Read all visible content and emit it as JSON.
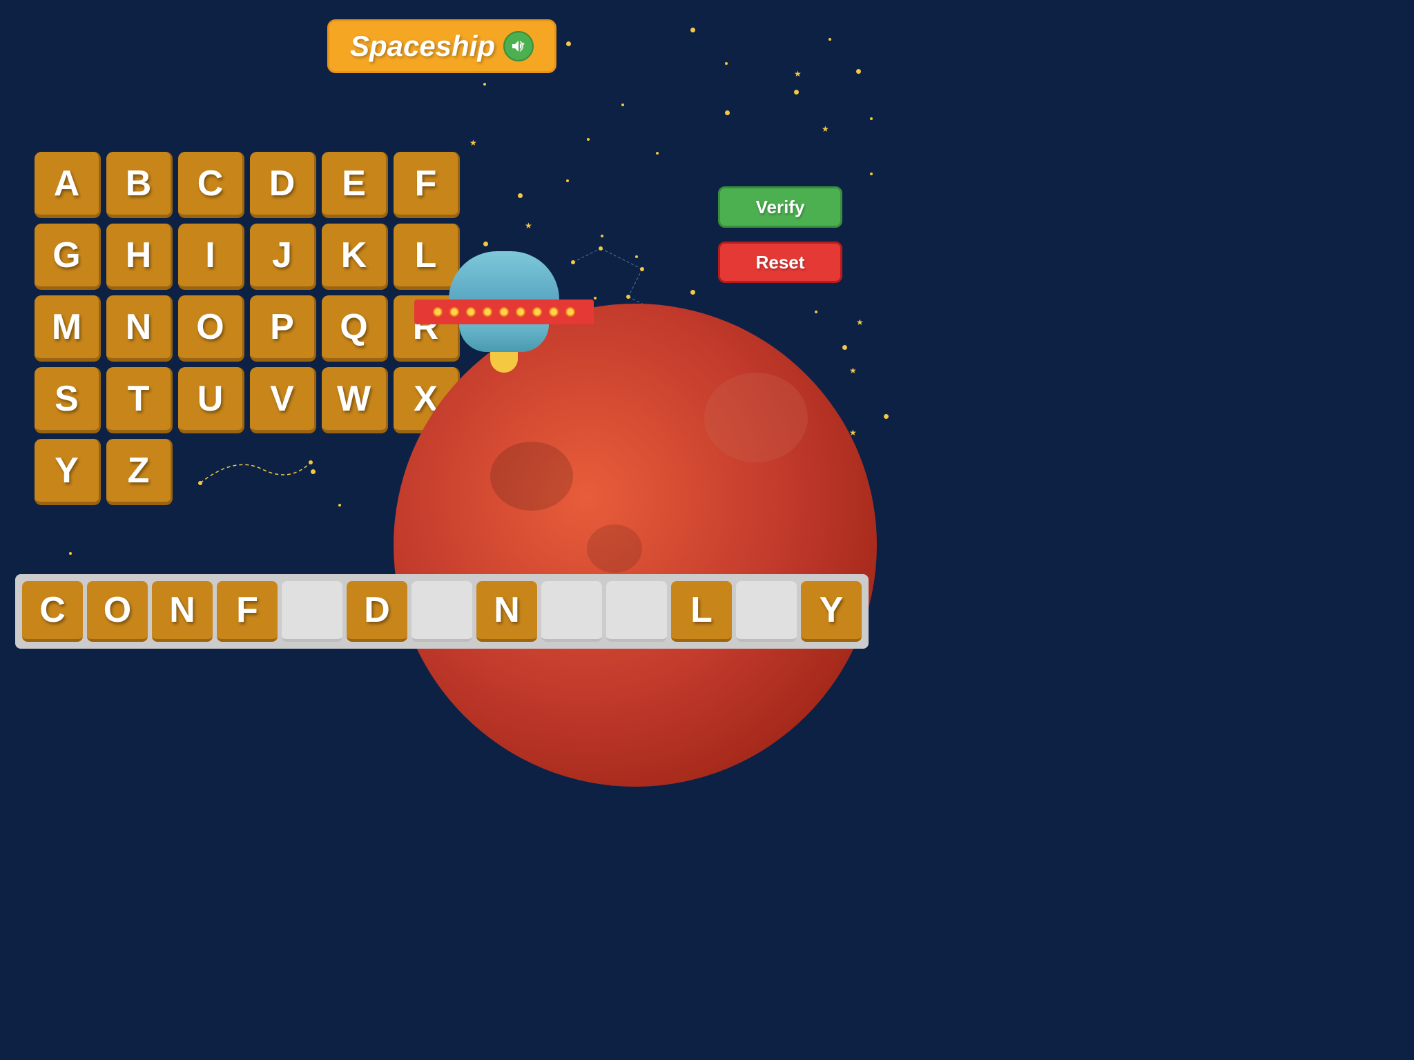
{
  "title": {
    "text": "Spaceship",
    "sound_label": "sound"
  },
  "alphabet": {
    "letters": [
      "A",
      "B",
      "C",
      "D",
      "E",
      "F",
      "G",
      "H",
      "I",
      "J",
      "K",
      "L",
      "M",
      "N",
      "O",
      "P",
      "Q",
      "R",
      "S",
      "T",
      "U",
      "V",
      "W",
      "X",
      "Y",
      "Z"
    ]
  },
  "buttons": {
    "verify": "Verify",
    "reset": "Reset"
  },
  "answer": {
    "tiles": [
      {
        "char": "C",
        "filled": true
      },
      {
        "char": "O",
        "filled": true
      },
      {
        "char": "N",
        "filled": true
      },
      {
        "char": "F",
        "filled": true
      },
      {
        "char": "_",
        "filled": false
      },
      {
        "char": "D",
        "filled": true
      },
      {
        "char": "_",
        "filled": false
      },
      {
        "char": "N",
        "filled": true
      },
      {
        "char": "_",
        "filled": false
      },
      {
        "char": "_",
        "filled": false
      },
      {
        "char": "L",
        "filled": true
      },
      {
        "char": "_",
        "filled": false
      },
      {
        "char": "Y",
        "filled": true
      }
    ]
  },
  "colors": {
    "bg": "#0d2145",
    "tile": "#c8861a",
    "verify": "#4caf50",
    "reset": "#e53935",
    "star": "#f5c842"
  }
}
